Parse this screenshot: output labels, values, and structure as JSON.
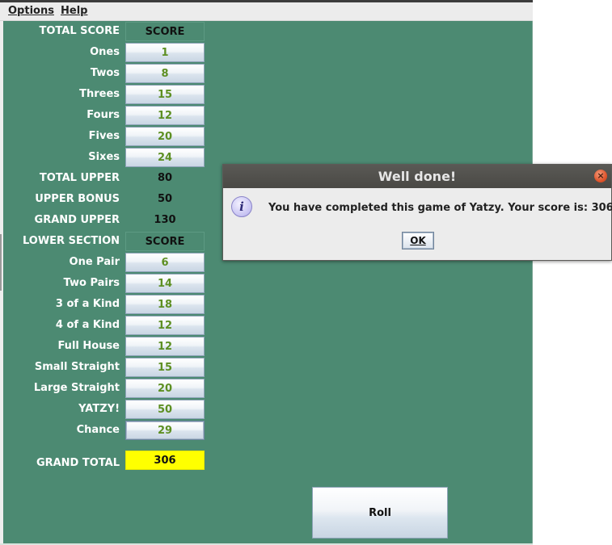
{
  "menubar": {
    "items": [
      "Options",
      "Help"
    ]
  },
  "scorecard": {
    "upper_header": {
      "label": "TOTAL SCORE",
      "column": "SCORE"
    },
    "upper_rows": [
      {
        "label": "Ones",
        "value": "1"
      },
      {
        "label": "Twos",
        "value": "8"
      },
      {
        "label": "Threes",
        "value": "15"
      },
      {
        "label": "Fours",
        "value": "12"
      },
      {
        "label": "Fives",
        "value": "20"
      },
      {
        "label": "Sixes",
        "value": "24"
      }
    ],
    "upper_totals": [
      {
        "label": "TOTAL UPPER",
        "value": "80"
      },
      {
        "label": "UPPER BONUS",
        "value": "50"
      },
      {
        "label": "GRAND UPPER",
        "value": "130"
      }
    ],
    "lower_header": {
      "label": "LOWER SECTION",
      "column": "SCORE"
    },
    "lower_rows": [
      {
        "label": "One Pair",
        "value": "6"
      },
      {
        "label": "Two Pairs",
        "value": "14"
      },
      {
        "label": "3 of a Kind",
        "value": "18"
      },
      {
        "label": "4 of a Kind",
        "value": "12"
      },
      {
        "label": "Full House",
        "value": "12"
      },
      {
        "label": "Small Straight",
        "value": "15"
      },
      {
        "label": "Large Straight",
        "value": "20"
      },
      {
        "label": "YATZY!",
        "value": "50"
      },
      {
        "label": "Chance",
        "value": "29"
      }
    ],
    "grand_total": {
      "label": "GRAND TOTAL",
      "value": "306"
    }
  },
  "roll_button": {
    "label": "Roll"
  },
  "dialog": {
    "title": "Well done!",
    "message": "You have completed this game of Yatzy. Your score is: 306",
    "ok_label": "OK",
    "close_glyph": "×",
    "icon_glyph": "i"
  },
  "colors": {
    "board": "#4c8a72",
    "score_value": "#5d8f22",
    "grand_total_bg": "#ffff00",
    "dialog_title_bg": "#4f4e4a",
    "close_button": "#e0552c"
  }
}
